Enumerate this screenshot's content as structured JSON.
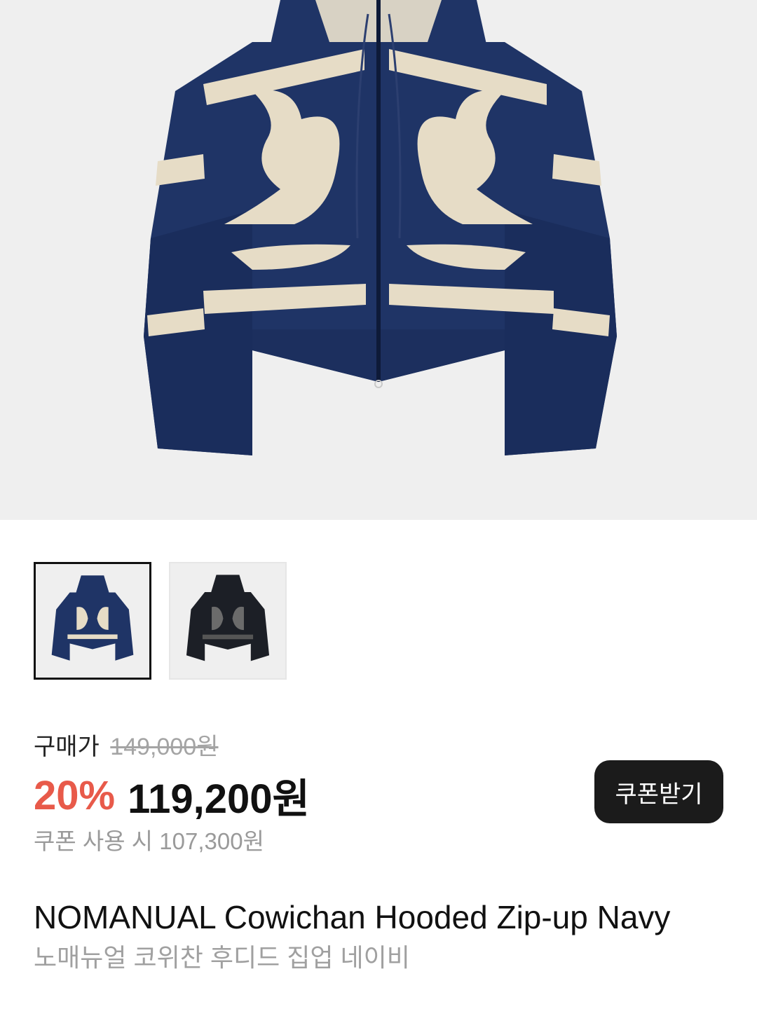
{
  "product": {
    "main_image_label": "hooded-zip-up-sweater-navy",
    "thumbnails": [
      {
        "label": "navy-colorway",
        "selected": true
      },
      {
        "label": "black-colorway",
        "selected": false
      }
    ],
    "price_label": "구매가",
    "original_price": "149,000원",
    "discount": "20%",
    "sale_price": "119,200원",
    "coupon_button": "쿠폰받기",
    "coupon_price_text": "쿠폰 사용 시 107,300원",
    "title_en": "NOMANUAL Cowichan Hooded Zip-up Navy",
    "title_ko": "노매뉴얼 코위찬 후디드 집업 네이비"
  },
  "colors": {
    "navy": "#1f3466",
    "cream": "#e6dcc6",
    "discount": "#e85a4a",
    "button_bg": "#1b1b1b"
  }
}
